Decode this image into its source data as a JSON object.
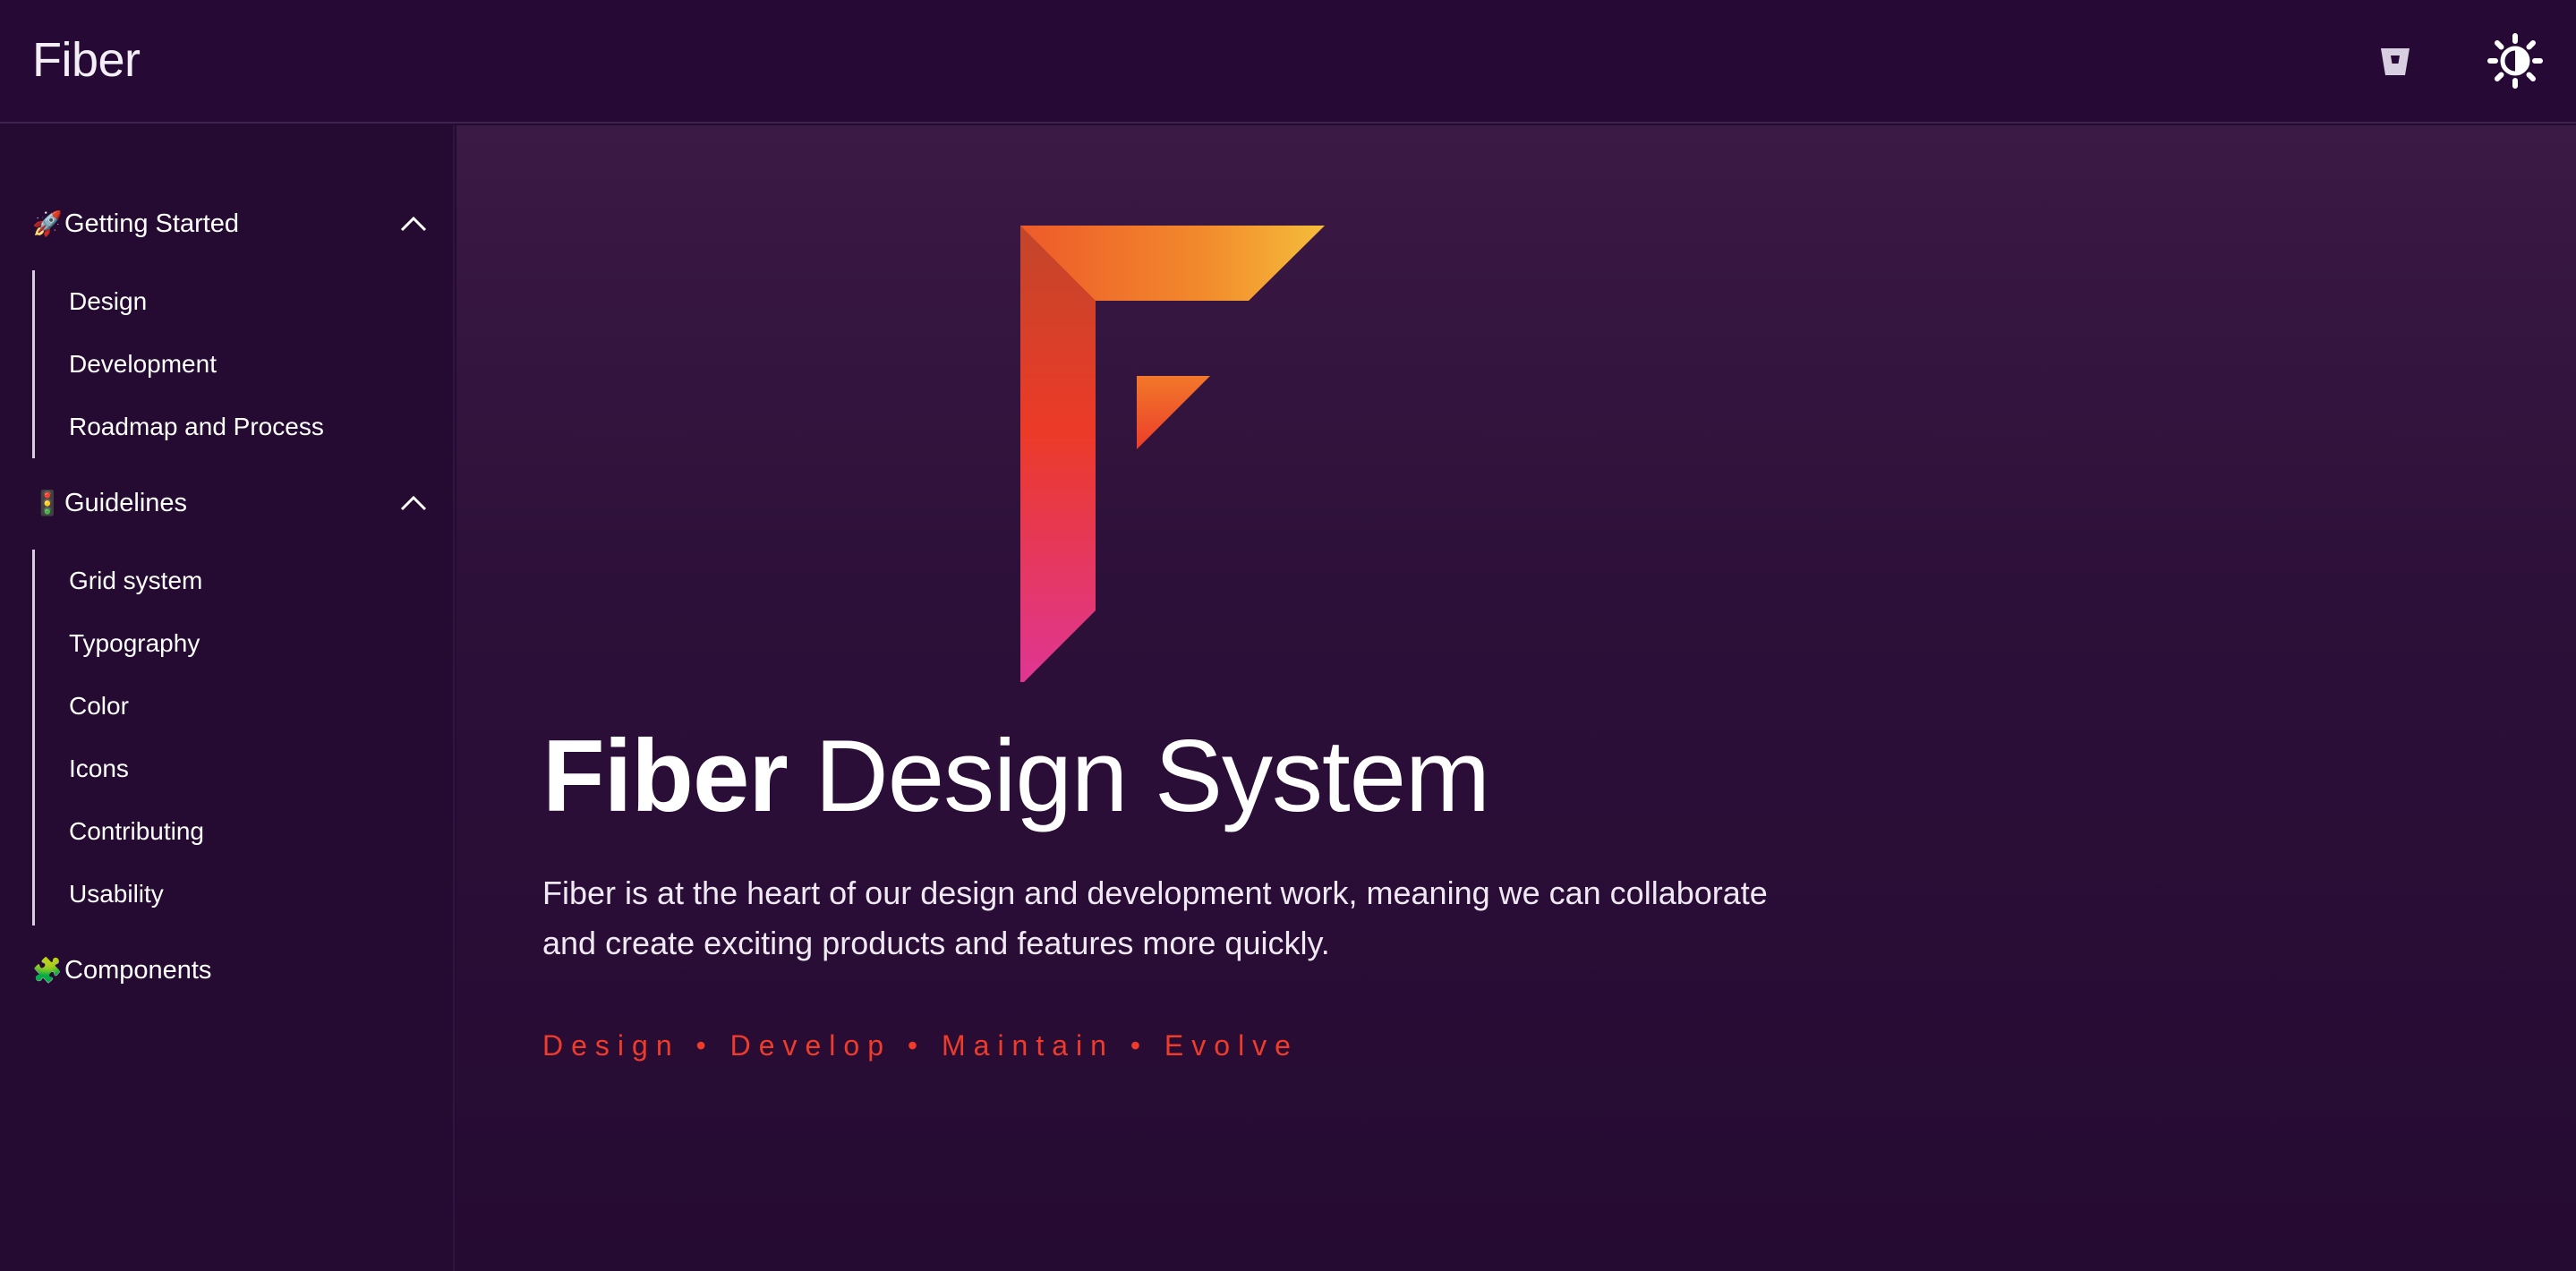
{
  "header": {
    "brand": "Fiber",
    "icons": [
      "bitbucket-icon",
      "theme-toggle-icon"
    ]
  },
  "sidebar": {
    "sections": [
      {
        "emoji": "🚀",
        "label": "Getting Started",
        "expanded": true,
        "items": [
          "Design",
          "Development",
          "Roadmap and Process"
        ]
      },
      {
        "emoji": "🚦",
        "label": "Guidelines",
        "expanded": true,
        "items": [
          "Grid system",
          "Typography",
          "Color",
          "Icons",
          "Contributing",
          "Usability"
        ]
      },
      {
        "emoji": "🧩",
        "label": "Components",
        "expanded": false,
        "items": []
      }
    ]
  },
  "hero": {
    "title_bold": "Fiber",
    "title_light": "Design System",
    "description": "Fiber is at the heart of our design and development work, meaning we can collaborate and create exciting products and features more quickly.",
    "tagline": "Design • Develop • Maintain • Evolve"
  },
  "colors": {
    "background": "#250a32",
    "accent": "#ee3b2a",
    "logo_orange": "#f07a2a",
    "logo_yellow": "#f5b93a",
    "logo_pink": "#e0358f"
  }
}
